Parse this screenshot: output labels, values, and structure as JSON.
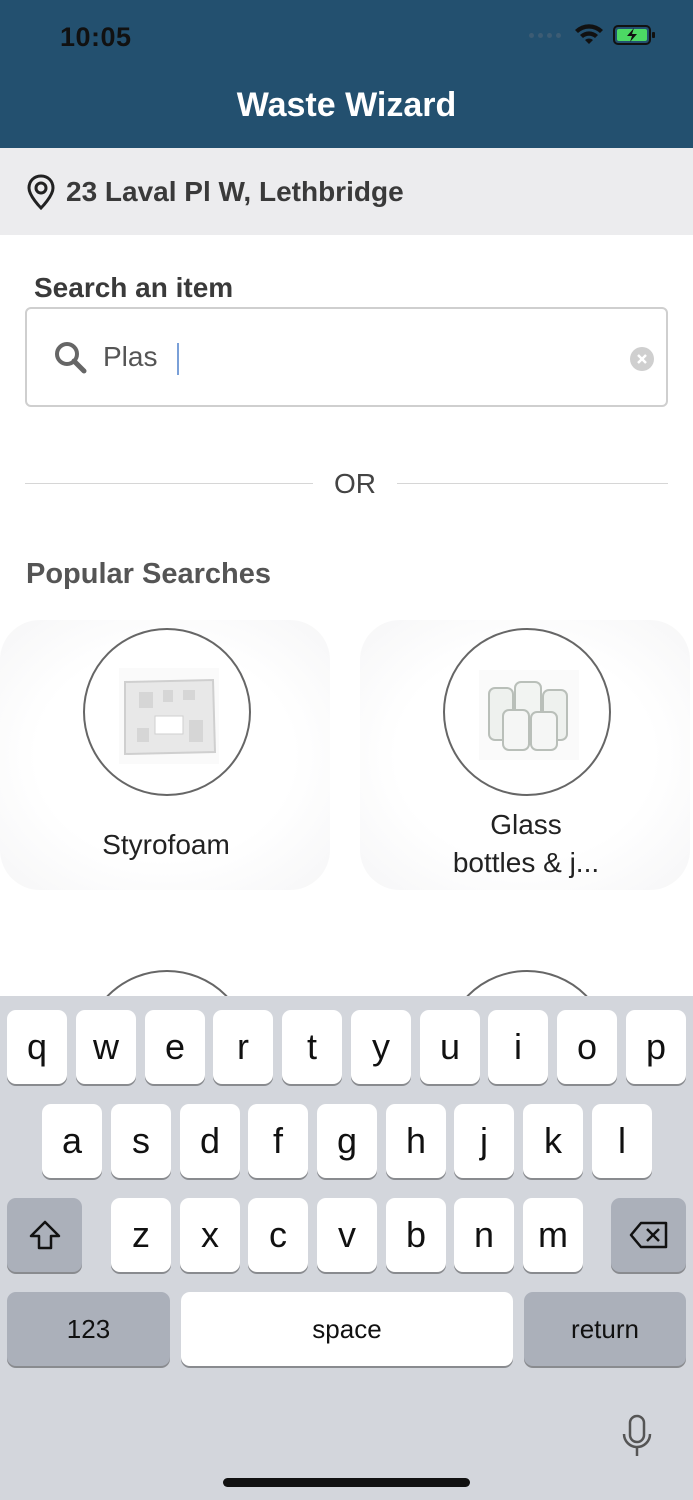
{
  "status_bar": {
    "time": "10:05"
  },
  "header": {
    "title": "Waste Wizard"
  },
  "address": {
    "text": "23 Laval Pl W, Lethbridge"
  },
  "search": {
    "label": "Search an item",
    "value": "Plas"
  },
  "divider": {
    "text": "OR"
  },
  "popular": {
    "title": "Popular Searches",
    "items": [
      {
        "label": "Styrofoam",
        "icon": "styrofoam-image"
      },
      {
        "label": "Glass",
        "label_line2": "bottles & j...",
        "icon": "glass-jars-image"
      }
    ]
  },
  "keyboard": {
    "row1": [
      "q",
      "w",
      "e",
      "r",
      "t",
      "y",
      "u",
      "i",
      "o",
      "p"
    ],
    "row2": [
      "a",
      "s",
      "d",
      "f",
      "g",
      "h",
      "j",
      "k",
      "l"
    ],
    "row3": [
      "z",
      "x",
      "c",
      "v",
      "b",
      "n",
      "m"
    ],
    "numbers_label": "123",
    "space_label": "space",
    "return_label": "return"
  },
  "colors": {
    "header_bg": "#23506f",
    "address_bg": "#ececee",
    "keyboard_bg": "#d3d6dc"
  }
}
